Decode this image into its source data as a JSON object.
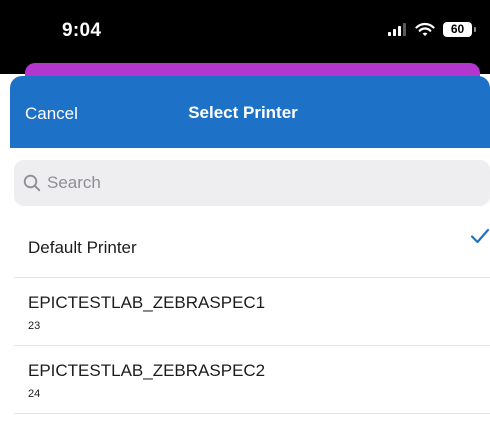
{
  "status_bar": {
    "time": "9:04",
    "battery": "60"
  },
  "nav": {
    "cancel_label": "Cancel",
    "title": "Select Printer"
  },
  "search": {
    "placeholder": "Search"
  },
  "printers": [
    {
      "name": "Default Printer",
      "selected": true
    },
    {
      "name": "EPICTESTLAB_ZEBRASPEC1",
      "detail": "23"
    },
    {
      "name": "EPICTESTLAB_ZEBRASPEC2",
      "detail": "24"
    }
  ],
  "colors": {
    "nav_bg": "#1d72c7",
    "accent_sheet": "#b337cf",
    "checkmark": "#1d72c7"
  }
}
